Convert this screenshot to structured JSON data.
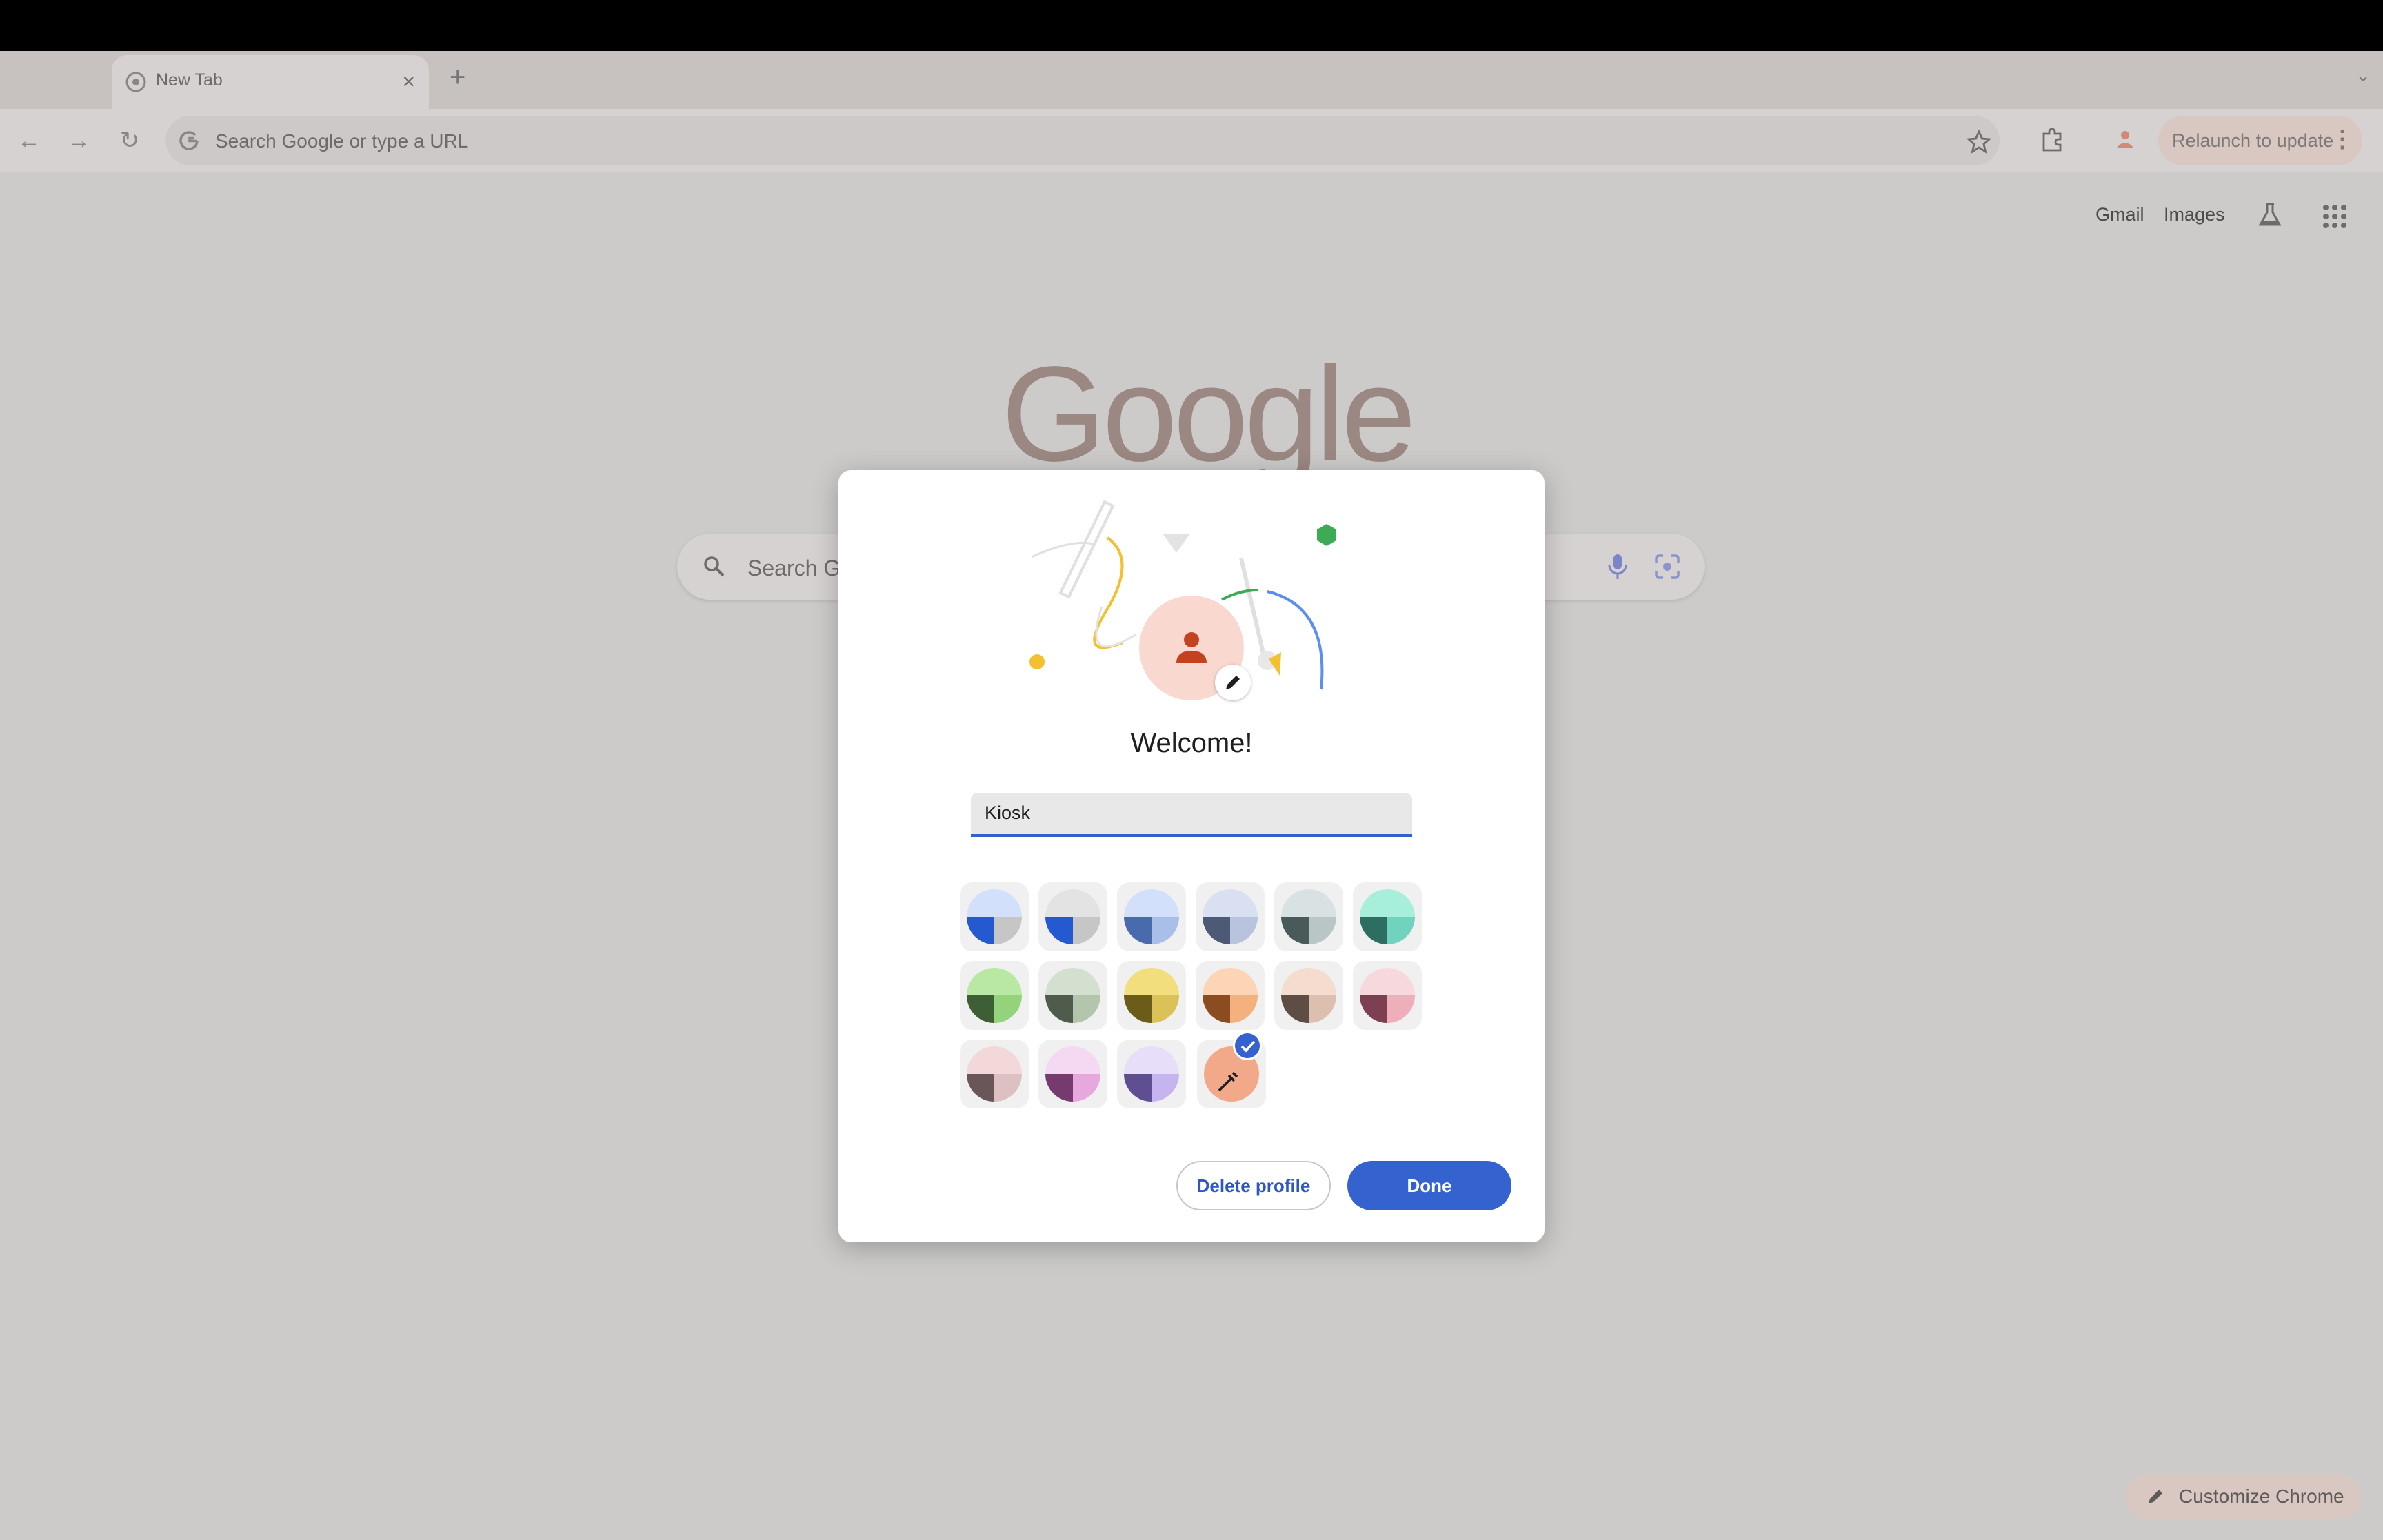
{
  "browser": {
    "tab_title": "New Tab",
    "tab_close": "×",
    "new_tab": "+",
    "tab_menu": "⌄",
    "omnibox_placeholder": "Search Google or type a URL",
    "relaunch_label": "Relaunch to update",
    "menu_dots": "⋮"
  },
  "ntp": {
    "gmail": "Gmail",
    "images": "Images",
    "logo": "Google",
    "search_placeholder": "Search G",
    "customize_label": "Customize Chrome"
  },
  "dialog": {
    "title": "Welcome!",
    "name_value": "Kiosk",
    "delete_label": "Delete profile",
    "done_label": "Done",
    "avatar_color": "#f9d9cf",
    "avatar_icon_color": "#c5421f",
    "accent": "#3463cf",
    "color_options": [
      {
        "light": "#d3e0fb",
        "mid": "#c6c6c6",
        "dark": "#2459d0"
      },
      {
        "light": "#e3e3e3",
        "mid": "#c6c6c6",
        "dark": "#2459d0"
      },
      {
        "light": "#d3e0fb",
        "mid": "#a9bfe8",
        "dark": "#4a6aae"
      },
      {
        "light": "#d8e0f2",
        "mid": "#b8c3dd",
        "dark": "#4d5a75"
      },
      {
        "light": "#d9e2e2",
        "mid": "#b8c6c6",
        "dark": "#4a5a5a"
      },
      {
        "light": "#a7eedb",
        "mid": "#6fd3bd",
        "dark": "#2e6e62"
      },
      {
        "light": "#b9e7a4",
        "mid": "#95d27c",
        "dark": "#3e5e36"
      },
      {
        "light": "#d3dfcf",
        "mid": "#b4c5ae",
        "dark": "#4f5c4d"
      },
      {
        "light": "#f2de7d",
        "mid": "#dbc258",
        "dark": "#6b5c19"
      },
      {
        "light": "#fbd5b5",
        "mid": "#f5b17d",
        "dark": "#8b4c1f"
      },
      {
        "light": "#f4dccf",
        "mid": "#dcbfae",
        "dark": "#5d4d44"
      },
      {
        "light": "#f7d9dd",
        "mid": "#eeafba",
        "dark": "#7f3f52"
      },
      {
        "light": "#f3d8da",
        "mid": "#dcc0c2",
        "dark": "#6a5658"
      },
      {
        "light": "#f5d8f1",
        "mid": "#e7a8dd",
        "dark": "#773a6f"
      },
      {
        "light": "#e7defa",
        "mid": "#c6b4f0",
        "dark": "#5f4e91"
      }
    ],
    "custom_color": "#f2a98a"
  }
}
